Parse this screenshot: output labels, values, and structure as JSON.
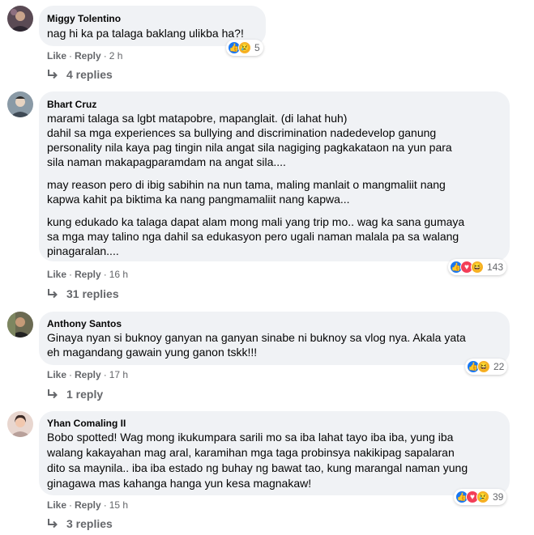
{
  "comments": [
    {
      "author": "Miggy Tolentino",
      "lines": [
        "nag hi ka pa talaga baklang ulikba ha?!"
      ],
      "like_label": "Like",
      "reply_label": "Reply",
      "time": "2 h",
      "reaction_icons": [
        "like-icon",
        "sad-icon"
      ],
      "reaction_count": "5",
      "replies_label": "4 replies"
    },
    {
      "author": "Bhart Cruz",
      "lines": [
        "marami talaga sa lgbt matapobre, mapanglait. (di lahat huh)",
        "dahil sa mga experiences sa bullying and discrimination nadedevelop ganung",
        "personality nila kaya pag tingin nila angat sila nagiging pagkakataon na yun para",
        "sila naman makapagparamdam na angat sila....",
        "may reason pero di ibig sabihin na nun tama, maling manlait o mangmaliit nang",
        "kapwa kahit pa biktima ka nang pangmamaliit nang kapwa...",
        "kung edukado ka talaga dapat alam mong mali yang trip mo.. wag ka sana gumaya",
        "sa mga may talino nga dahil sa edukasyon pero ugali naman malala pa sa walang",
        "pinagaralan...."
      ],
      "like_label": "Like",
      "reply_label": "Reply",
      "time": "16 h",
      "reaction_icons": [
        "like-icon",
        "heart-icon",
        "haha-icon"
      ],
      "reaction_count": "143",
      "replies_label": "31 replies"
    },
    {
      "author": "Anthony Santos",
      "lines": [
        "Ginaya nyan si buknoy ganyan na ganyan sinabe ni buknoy sa vlog nya. Akala yata",
        "eh magandang gawain yung ganon tskk!!!"
      ],
      "like_label": "Like",
      "reply_label": "Reply",
      "time": "17 h",
      "reaction_icons": [
        "like-icon",
        "haha-icon"
      ],
      "reaction_count": "22",
      "replies_label": "1 reply"
    },
    {
      "author": "Yhan Comaling II",
      "lines": [
        "Bobo spotted! Wag mong ikukumpara sarili mo sa iba lahat tayo iba iba, yung iba",
        "walang kakayahan mag aral, karamihan mga taga probinsya nakikipag sapalaran",
        "dito sa maynila.. iba iba estado ng buhay ng bawat tao, kung marangal naman yung",
        "ginagawa mas kahanga hanga yun kesa magnakaw!"
      ],
      "like_label": "Like",
      "reply_label": "Reply",
      "time": "15 h",
      "reaction_icons": [
        "like-icon",
        "heart-icon",
        "sad-icon"
      ],
      "reaction_count": "39",
      "replies_label": "3 replies"
    }
  ]
}
